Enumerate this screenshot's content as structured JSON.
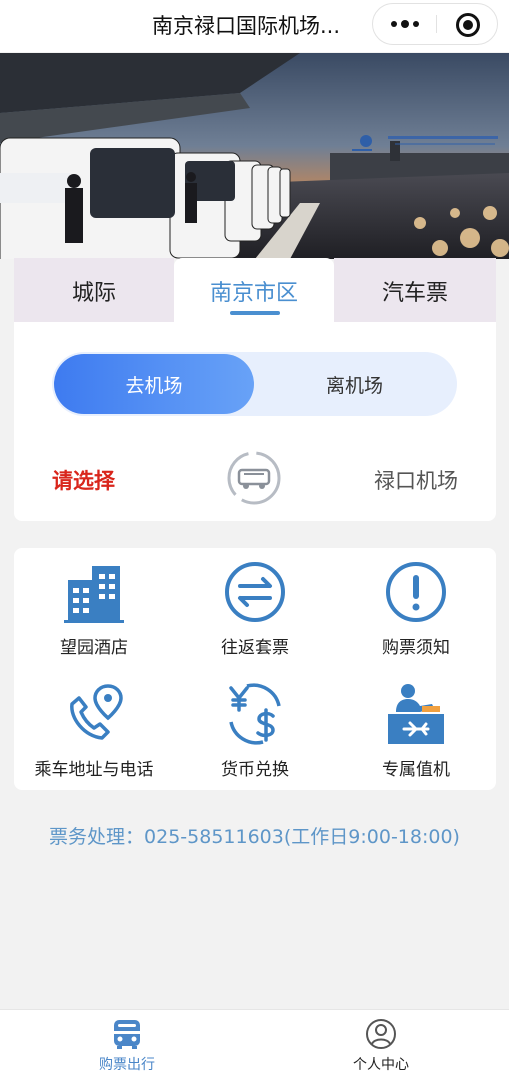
{
  "header": {
    "title": "南京禄口国际机场..."
  },
  "banner": {
    "slide_count": 3,
    "active_slide": 3
  },
  "tabs": [
    {
      "label": "城际",
      "active": false
    },
    {
      "label": "南京市区",
      "active": true
    },
    {
      "label": "汽车票",
      "active": false
    }
  ],
  "direction": {
    "to_airport": "去机场",
    "from_airport": "离机场",
    "selected": "去机场"
  },
  "route": {
    "origin_placeholder": "请选择",
    "destination": "禄口机场"
  },
  "services": [
    {
      "label": "望园酒店",
      "icon": "hotel-building-icon"
    },
    {
      "label": "往返套票",
      "icon": "round-trip-arrows-icon"
    },
    {
      "label": "购票须知",
      "icon": "exclamation-notice-icon"
    },
    {
      "label": "乘车地址与电话",
      "icon": "phone-location-icon"
    },
    {
      "label": "货币兑换",
      "icon": "currency-exchange-icon"
    },
    {
      "label": "专属值机",
      "icon": "checkin-counter-icon"
    }
  ],
  "hotline": "票务处理：025-58511603(工作日9:00-18:00)",
  "tabbar": [
    {
      "label": "购票出行",
      "icon": "bus-icon",
      "active": true
    },
    {
      "label": "个人中心",
      "icon": "user-icon",
      "active": false
    }
  ],
  "colors": {
    "accent": "#4a8fd0",
    "alert": "#d9261c",
    "toggle_active": "#3e7bf0"
  }
}
